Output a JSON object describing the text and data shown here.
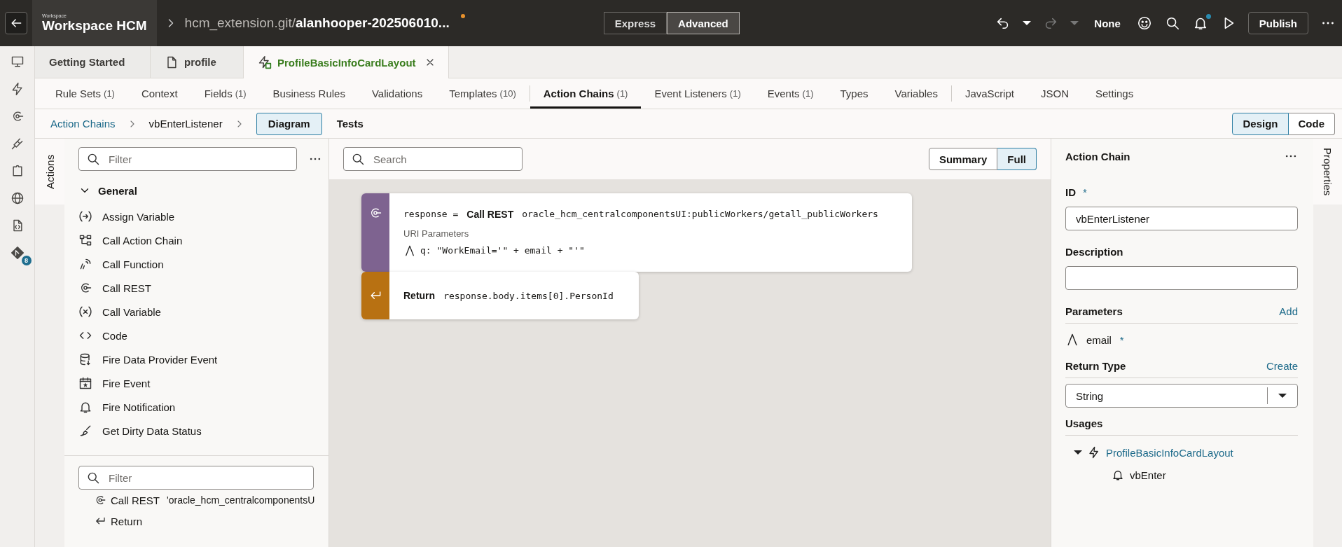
{
  "top_bar": {
    "workspace_caption": "Workspace",
    "workspace": "Workspace HCM",
    "repo": "hcm_extension.git/",
    "branch": "alanhooper-202506010...",
    "unsaved": true,
    "modes": [
      {
        "label": "Express",
        "selected": false
      },
      {
        "label": "Advanced",
        "selected": true
      }
    ],
    "profile": "None",
    "notifications_unread": true,
    "publish": "Publish"
  },
  "rail": {
    "badge": "8"
  },
  "file_tabs": [
    {
      "label": "Getting Started",
      "selected": false,
      "closable": false
    },
    {
      "label": "profile",
      "selected": false,
      "closable": false
    },
    {
      "label": "ProfileBasicInfoCardLayout",
      "selected": true,
      "closable": true
    }
  ],
  "editor_tabs": [
    {
      "label": "Rule Sets",
      "count": "(1)",
      "selected": false,
      "divider_after": false
    },
    {
      "label": "Context",
      "selected": false,
      "divider_after": false
    },
    {
      "label": "Fields",
      "count": "(1)",
      "selected": false,
      "divider_after": false
    },
    {
      "label": "Business Rules",
      "selected": false,
      "divider_after": false
    },
    {
      "label": "Validations",
      "selected": false,
      "divider_after": false
    },
    {
      "label": "Templates",
      "count": "(10)",
      "selected": false,
      "divider_after": true
    },
    {
      "label": "Action Chains",
      "count": "(1)",
      "selected": true,
      "divider_after": false
    },
    {
      "label": "Event Listeners",
      "count": "(1)",
      "selected": false,
      "divider_after": false
    },
    {
      "label": "Events",
      "count": "(1)",
      "selected": false,
      "divider_after": false
    },
    {
      "label": "Types",
      "selected": false,
      "divider_after": false
    },
    {
      "label": "Variables",
      "selected": false,
      "divider_after": true
    },
    {
      "label": "JavaScript",
      "selected": false,
      "divider_after": false
    },
    {
      "label": "JSON",
      "selected": false,
      "divider_after": false
    },
    {
      "label": "Settings",
      "selected": false,
      "divider_after": false
    }
  ],
  "breadcrumb": {
    "items": [
      {
        "label": "Action Chains",
        "kind": "link"
      },
      {
        "label": "vbEnterListener",
        "kind": "text"
      }
    ],
    "views": [
      {
        "label": "Diagram",
        "selected": true
      },
      {
        "label": "Tests",
        "selected": false
      }
    ],
    "editor_modes": [
      {
        "label": "Design",
        "selected": true
      },
      {
        "label": "Code",
        "selected": false
      }
    ]
  },
  "actions_panel": {
    "tab": "Actions",
    "filter_placeholder": "Filter",
    "group": {
      "label": "General",
      "expanded": true,
      "items": [
        {
          "label": "Assign Variable"
        },
        {
          "label": "Call Action Chain"
        },
        {
          "label": "Call Function"
        },
        {
          "label": "Call REST"
        },
        {
          "label": "Call Variable"
        },
        {
          "label": "Code"
        },
        {
          "label": "Fire Data Provider Event"
        },
        {
          "label": "Fire Event"
        },
        {
          "label": "Fire Notification"
        },
        {
          "label": "Get Dirty Data Status"
        }
      ]
    },
    "structure": {
      "filter_placeholder": "Filter",
      "items": [
        {
          "kind": "rest",
          "label": "Call REST",
          "detail": "'oracle_hcm_centralcomponentsU"
        },
        {
          "kind": "return",
          "label": "Return"
        }
      ]
    }
  },
  "canvas": {
    "search_placeholder": "Search",
    "views": [
      {
        "label": "Summary",
        "selected": false
      },
      {
        "label": "Full",
        "selected": true
      }
    ],
    "nodes": [
      {
        "kind": "rest",
        "target": "response =",
        "action": "Call REST",
        "endpoint": "oracle_hcm_centralcomponentsUI:publicWorkers/getall_publicWorkers",
        "section": "URI Parameters",
        "params": [
          "q: \"WorkEmail='\" + email + \"'\""
        ]
      },
      {
        "kind": "return",
        "action": "Return",
        "expression": "response.body.items[0].PersonId"
      }
    ]
  },
  "properties": {
    "tab": "Properties",
    "title": "Action Chain",
    "id_label": "ID",
    "id_required": "*",
    "id_value": "vbEnterListener",
    "description_label": "Description",
    "parameters_label": "Parameters",
    "add_link": "Add",
    "parameters": [
      {
        "name": "email",
        "required": "*"
      }
    ],
    "return_type_label": "Return Type",
    "create_link": "Create",
    "return_type": "String",
    "usages_label": "Usages",
    "usages": [
      {
        "label": "ProfileBasicInfoCardLayout",
        "expanded": true,
        "children": [
          {
            "label": "vbEnter"
          }
        ]
      }
    ]
  }
}
